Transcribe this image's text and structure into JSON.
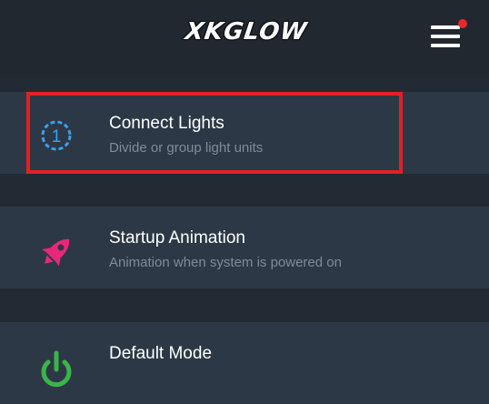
{
  "header": {
    "logo_text": "XKGLOW",
    "menu_icon": "hamburger-menu-icon",
    "notification_dot_color": "#e5292e"
  },
  "menu_items": [
    {
      "title": "Connect Lights",
      "subtitle": "Divide or group light units",
      "icon": "step-1-circle-icon",
      "icon_text": "1",
      "icon_color": "#3aa0e8",
      "highlighted": true
    },
    {
      "title": "Startup Animation",
      "subtitle": "Animation when system is powered on",
      "icon": "rocket-icon",
      "icon_color": "#e6287a"
    },
    {
      "title": "Default Mode",
      "subtitle": "",
      "icon": "power-icon",
      "icon_color": "#3ab54a"
    }
  ],
  "highlight_color": "#e41f26"
}
